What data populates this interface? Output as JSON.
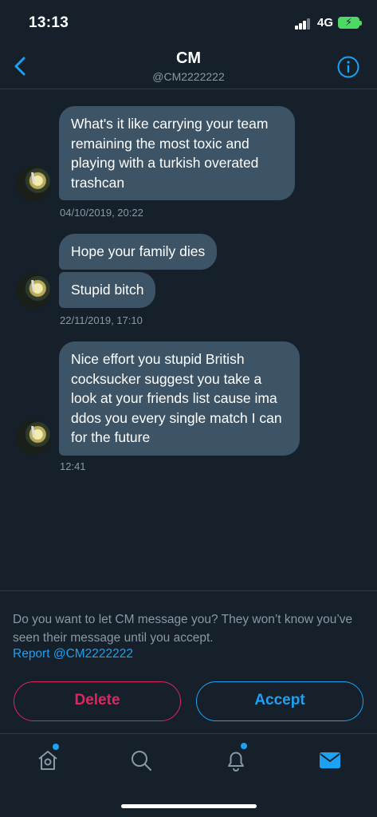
{
  "status_bar": {
    "time": "13:13",
    "network": "4G"
  },
  "header": {
    "title": "CM",
    "handle": "@CM2222222"
  },
  "messages": [
    {
      "bubbles": [
        "What's it like carrying your team remaining the most toxic and playing with a turkish overated trashcan"
      ],
      "timestamp": "04/10/2019, 20:22"
    },
    {
      "bubbles": [
        "Hope your family dies",
        "Stupid bitch"
      ],
      "timestamp": "22/11/2019, 17:10"
    },
    {
      "bubbles": [
        "Nice effort you stupid British cocksucker suggest you take a look at your friends list cause ima ddos you every single match I can for the future"
      ],
      "timestamp": "12:41"
    }
  ],
  "request": {
    "text": "Do you want to let CM message you? They won’t know you’ve seen their message until you accept.",
    "report_link": "Report @CM2222222",
    "delete_label": "Delete",
    "accept_label": "Accept"
  },
  "tabbar": {
    "items": [
      {
        "icon": "home-icon",
        "active": false,
        "badge": true
      },
      {
        "icon": "search-icon",
        "active": false,
        "badge": false
      },
      {
        "icon": "bell-icon",
        "active": false,
        "badge": true
      },
      {
        "icon": "mail-icon",
        "active": true,
        "badge": false
      }
    ]
  },
  "colors": {
    "background": "#15202b",
    "bubble": "#3d5466",
    "accent": "#1da1f2",
    "danger": "#e0245e",
    "muted": "#8899a6"
  }
}
